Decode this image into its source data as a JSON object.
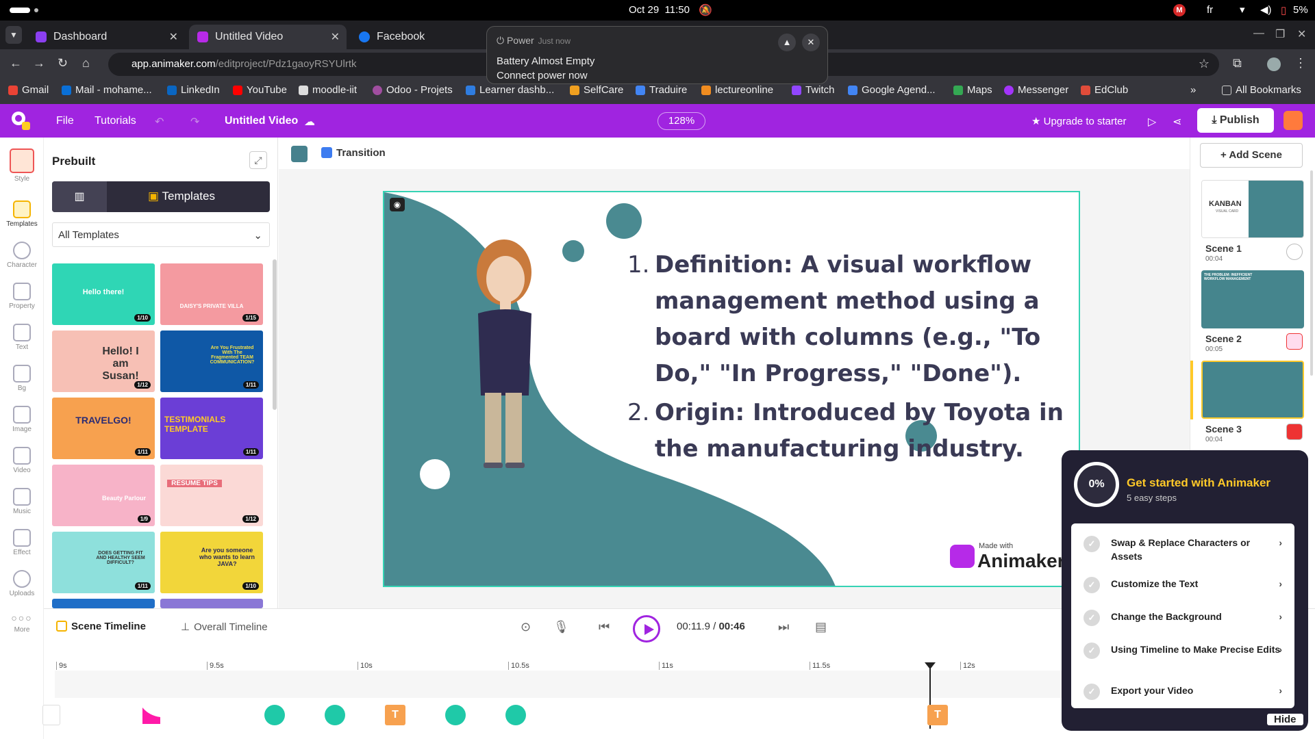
{
  "os": {
    "date": "Oct 29",
    "time": "11:50",
    "lang": "fr",
    "battery": "5%",
    "rec_letter": "M"
  },
  "tabs": [
    {
      "label": "Dashboard",
      "color": "#8b3ff0"
    },
    {
      "label": "Untitled Video",
      "color": "#b82ae8"
    },
    {
      "label": "Facebook",
      "color": "#1877f2"
    }
  ],
  "url": {
    "host": "app.animaker.com",
    "path": "/editproject/Pdz1gaoyRSYUlrtk"
  },
  "bookmarks": [
    {
      "label": "Gmail",
      "color": "#ea4335"
    },
    {
      "label": "Mail - mohame...",
      "color": "#0a6fd6"
    },
    {
      "label": "LinkedIn",
      "color": "#0a66c2"
    },
    {
      "label": "YouTube",
      "color": "#ff0000"
    },
    {
      "label": "moodle-iit",
      "color": "#dddddd"
    },
    {
      "label": "Odoo - Projets",
      "color": "#a04ea0"
    },
    {
      "label": "Learner dashb...",
      "color": "#2f7de1"
    },
    {
      "label": "SelfCare",
      "color": "#f0a020"
    },
    {
      "label": "Traduire",
      "color": "#4285f4"
    },
    {
      "label": "lectureonline",
      "color": "#f08c20"
    },
    {
      "label": "Twitch",
      "color": "#9146ff"
    },
    {
      "label": "Google Agend...",
      "color": "#4285f4"
    },
    {
      "label": "Maps",
      "color": "#34a853"
    },
    {
      "label": "Messenger",
      "color": "#a334fa"
    },
    {
      "label": "EdClub",
      "color": "#e04c3a"
    }
  ],
  "bookmarks_more": "»",
  "all_bookmarks": "All Bookmarks",
  "notification": {
    "app": "Power",
    "when": "Just now",
    "line1": "Battery Almost Empty",
    "line2": "Connect power now"
  },
  "header": {
    "file": "File",
    "tutorials": "Tutorials",
    "project": "Untitled Video",
    "zoom": "128%",
    "upgrade": "★ Upgrade to starter",
    "publish": "Publish"
  },
  "rail": [
    "Style",
    "Templates",
    "Character",
    "Property",
    "Text",
    "Bg",
    "Image",
    "Video",
    "Music",
    "Effect",
    "Uploads",
    "More"
  ],
  "panel": {
    "title": "Prebuilt",
    "tab": "Templates",
    "filter": "All Templates"
  },
  "templates": [
    {
      "caption": "Hello there!",
      "count": "1/10",
      "bg": "#2fd6b5"
    },
    {
      "caption": "DAISY'S PRIVATE VILLA",
      "count": "1/15",
      "bg": "#f49aa0"
    },
    {
      "caption": "Hello! I am Susan!",
      "count": "1/12",
      "bg": "#f7c0b5"
    },
    {
      "caption": "Are You Frustrated With The Fragmented TEAM COMMUNICATION?",
      "count": "1/11",
      "bg": "#0f58a6"
    },
    {
      "caption": "TRAVELGO!",
      "count": "1/11",
      "bg": "#f7a14f"
    },
    {
      "caption": "TESTIMONIALS TEMPLATE",
      "count": "1/11",
      "bg": "#6b3ed6"
    },
    {
      "caption": "Beauty Parlour",
      "count": "1/9",
      "bg": "#f7b3c8"
    },
    {
      "caption": "RESUME TIPS",
      "count": "1/12",
      "bg": "#fbd9d6"
    },
    {
      "caption": "DOES GETTING FIT AND HEALTHY SEEM DIFFICULT?",
      "count": "1/11",
      "bg": "#8ee0dc"
    },
    {
      "caption": "Are you someone who wants to learn JAVA?",
      "count": "1/10",
      "bg": "#f2d63a"
    }
  ],
  "stage": {
    "transition": "Transition"
  },
  "slide": {
    "items": [
      {
        "num": "1.",
        "text": "Definition: A visual workflow management method using a board with columns (e.g., \"To Do,\" \"In Progress,\" \"Done\")."
      },
      {
        "num": "2.",
        "text": "Origin: Introduced by Toyota in the manufacturing industry."
      }
    ],
    "made_with": "Made with",
    "brand": "Animaker",
    "accent": "#4a8a91"
  },
  "scenes": {
    "add": "+ Add Scene",
    "list": [
      {
        "label": "Scene 1",
        "dur": "00:04",
        "thumb_title": "KANBAN",
        "thumb_sub": "VISUAL CARD"
      },
      {
        "label": "Scene 2",
        "dur": "00:05",
        "thumb_title": "THE PROBLEM: INEFFICIENT WORKFLOW MANAGEMENT",
        "thumb_sub": ""
      },
      {
        "label": "Scene 3",
        "dur": "00:04",
        "thumb_title": "",
        "thumb_sub": ""
      }
    ]
  },
  "timeline": {
    "scene_tab": "Scene Timeline",
    "overall_tab": "Overall Timeline",
    "current": "00:11.9",
    "sep": "/",
    "total": "00:46",
    "ticks": [
      "9s",
      "9.5s",
      "10s",
      "10.5s",
      "11s",
      "11.5s",
      "12s"
    ]
  },
  "onboarding": {
    "progress": "0%",
    "title": "Get started with Animaker",
    "subtitle": "5 easy steps",
    "steps": [
      "Swap & Replace Characters or Assets",
      "Customize the Text",
      "Change the Background",
      "Using Timeline to Make Precise Edits",
      "Export your Video"
    ],
    "hide": "Hide"
  }
}
